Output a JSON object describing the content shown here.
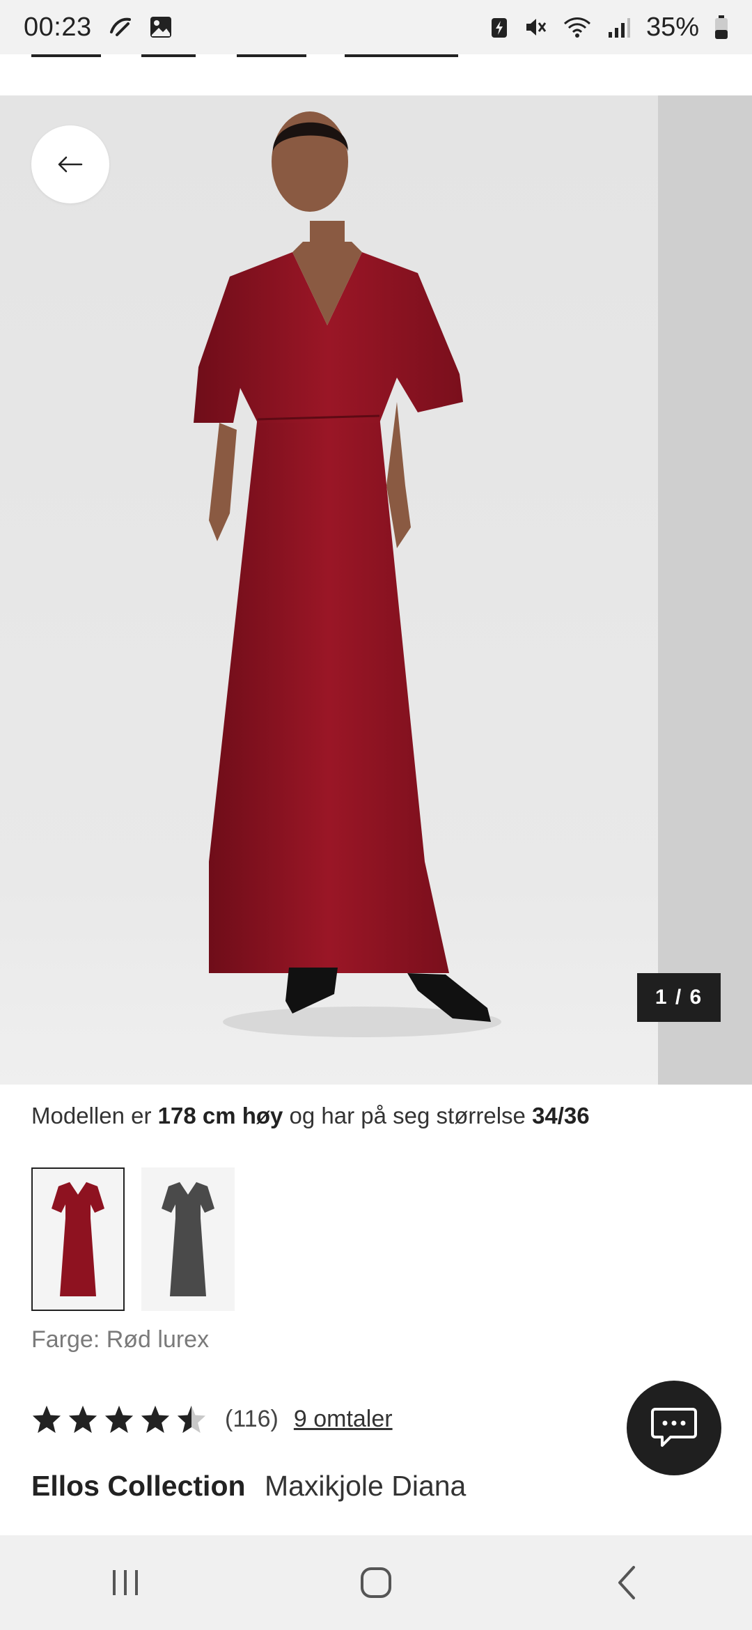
{
  "status_bar": {
    "time": "00:23",
    "battery": "35%"
  },
  "image_gallery": {
    "counter": "1 / 6"
  },
  "product": {
    "model_info": {
      "prefix": "Modellen er",
      "height": "178 cm høy",
      "middle": "og har på seg størrelse",
      "size": "34/36"
    },
    "color_label": "Farge: Rød lurex",
    "swatches": [
      {
        "name": "Rød lurex",
        "color": "#8e1220",
        "selected": true
      },
      {
        "name": "Grå lurex",
        "color": "#4a4a4a",
        "selected": false
      }
    ],
    "rating": {
      "value": 4.5,
      "max": 5,
      "count": "(116)",
      "reviews_link": "9 omtaler"
    },
    "brand": "Ellos Collection",
    "name": "Maxikjole Diana"
  },
  "colors": {
    "dress": "#8e1220",
    "backdrop": "#e6e6e6",
    "dark": "#1f1f1f"
  },
  "icons": [
    "back-arrow-icon",
    "chat-icon",
    "star-icon",
    "recent-apps-icon",
    "home-icon",
    "nav-back-icon"
  ]
}
